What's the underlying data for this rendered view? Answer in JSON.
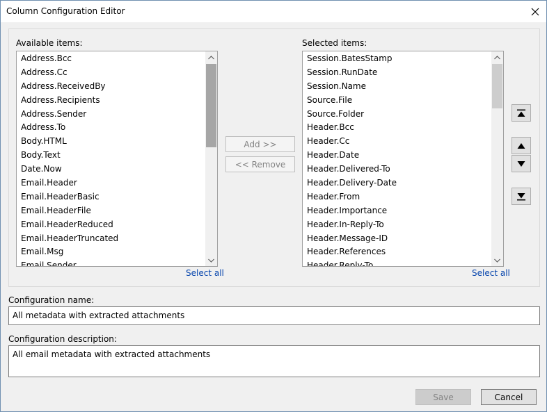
{
  "window": {
    "title": "Column Configuration Editor"
  },
  "available": {
    "label": "Available items:",
    "items": [
      "Address.Bcc",
      "Address.Cc",
      "Address.ReceivedBy",
      "Address.Recipients",
      "Address.Sender",
      "Address.To",
      "Body.HTML",
      "Body.Text",
      "Date.Now",
      "Email.Header",
      "Email.HeaderBasic",
      "Email.HeaderFile",
      "Email.HeaderReduced",
      "Email.HeaderTruncated",
      "Email.Msg",
      "Email.Sender"
    ],
    "select_all": "Select all"
  },
  "selected": {
    "label": "Selected items:",
    "items": [
      "Session.BatesStamp",
      "Session.RunDate",
      "Session.Name",
      "Source.File",
      "Source.Folder",
      "Header.Bcc",
      "Header.Cc",
      "Header.Date",
      "Header.Delivered-To",
      "Header.Delivery-Date",
      "Header.From",
      "Header.Importance",
      "Header.In-Reply-To",
      "Header.Message-ID",
      "Header.References",
      "Header.Reply-To"
    ],
    "select_all": "Select all"
  },
  "actions": {
    "add_label": "Add >>",
    "remove_label": "<< Remove"
  },
  "icons": {
    "close": "close-icon",
    "move_top": "move-to-top-icon",
    "move_up": "move-up-icon",
    "move_down": "move-down-icon",
    "move_bottom": "move-to-bottom-icon"
  },
  "config_name": {
    "label": "Configuration name:",
    "value": "All metadata with extracted attachments"
  },
  "config_description": {
    "label": "Configuration description:",
    "value": "All email metadata with extracted attachments"
  },
  "footer": {
    "save_label": "Save",
    "cancel_label": "Cancel"
  },
  "colors": {
    "link": "#0645ad",
    "window_border": "#6f8fb0",
    "background": "#f0f0f0"
  }
}
